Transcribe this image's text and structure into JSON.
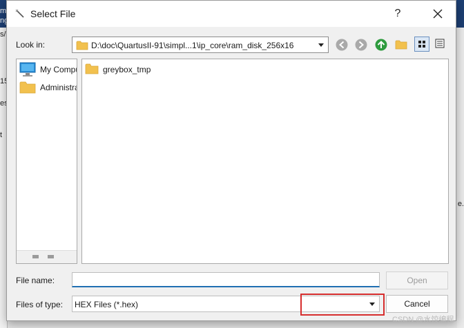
{
  "background": {
    "top_text": [
      "m",
      "ng",
      "s/"
    ],
    "left_text": [
      "15",
      "es",
      "t"
    ],
    "right_text": "e."
  },
  "dialog": {
    "title": "Select File",
    "help_label": "?",
    "look_in_label": "Look in:",
    "look_in_path": "D:\\doc\\QuartusII-91\\simpl...1\\ip_core\\ram_disk_256x16",
    "sidebar_items": [
      {
        "label": "My Computer",
        "icon": "computer-icon"
      },
      {
        "label": "Administrator",
        "icon": "folder-icon"
      }
    ],
    "files": [
      {
        "name": "greybox_tmp",
        "icon": "folder-icon"
      }
    ],
    "file_name_label": "File name:",
    "file_name_value": "",
    "file_type_label": "Files of type:",
    "file_type_value": "HEX Files (*.hex)",
    "open_label": "Open",
    "cancel_label": "Cancel"
  },
  "watermark": "CSDN @水饺编程",
  "colors": {
    "folder": "#f2c14e",
    "accent": "#1f6fb2",
    "highlight": "#d62c2c",
    "up_arrow": "#2e9b3e"
  }
}
